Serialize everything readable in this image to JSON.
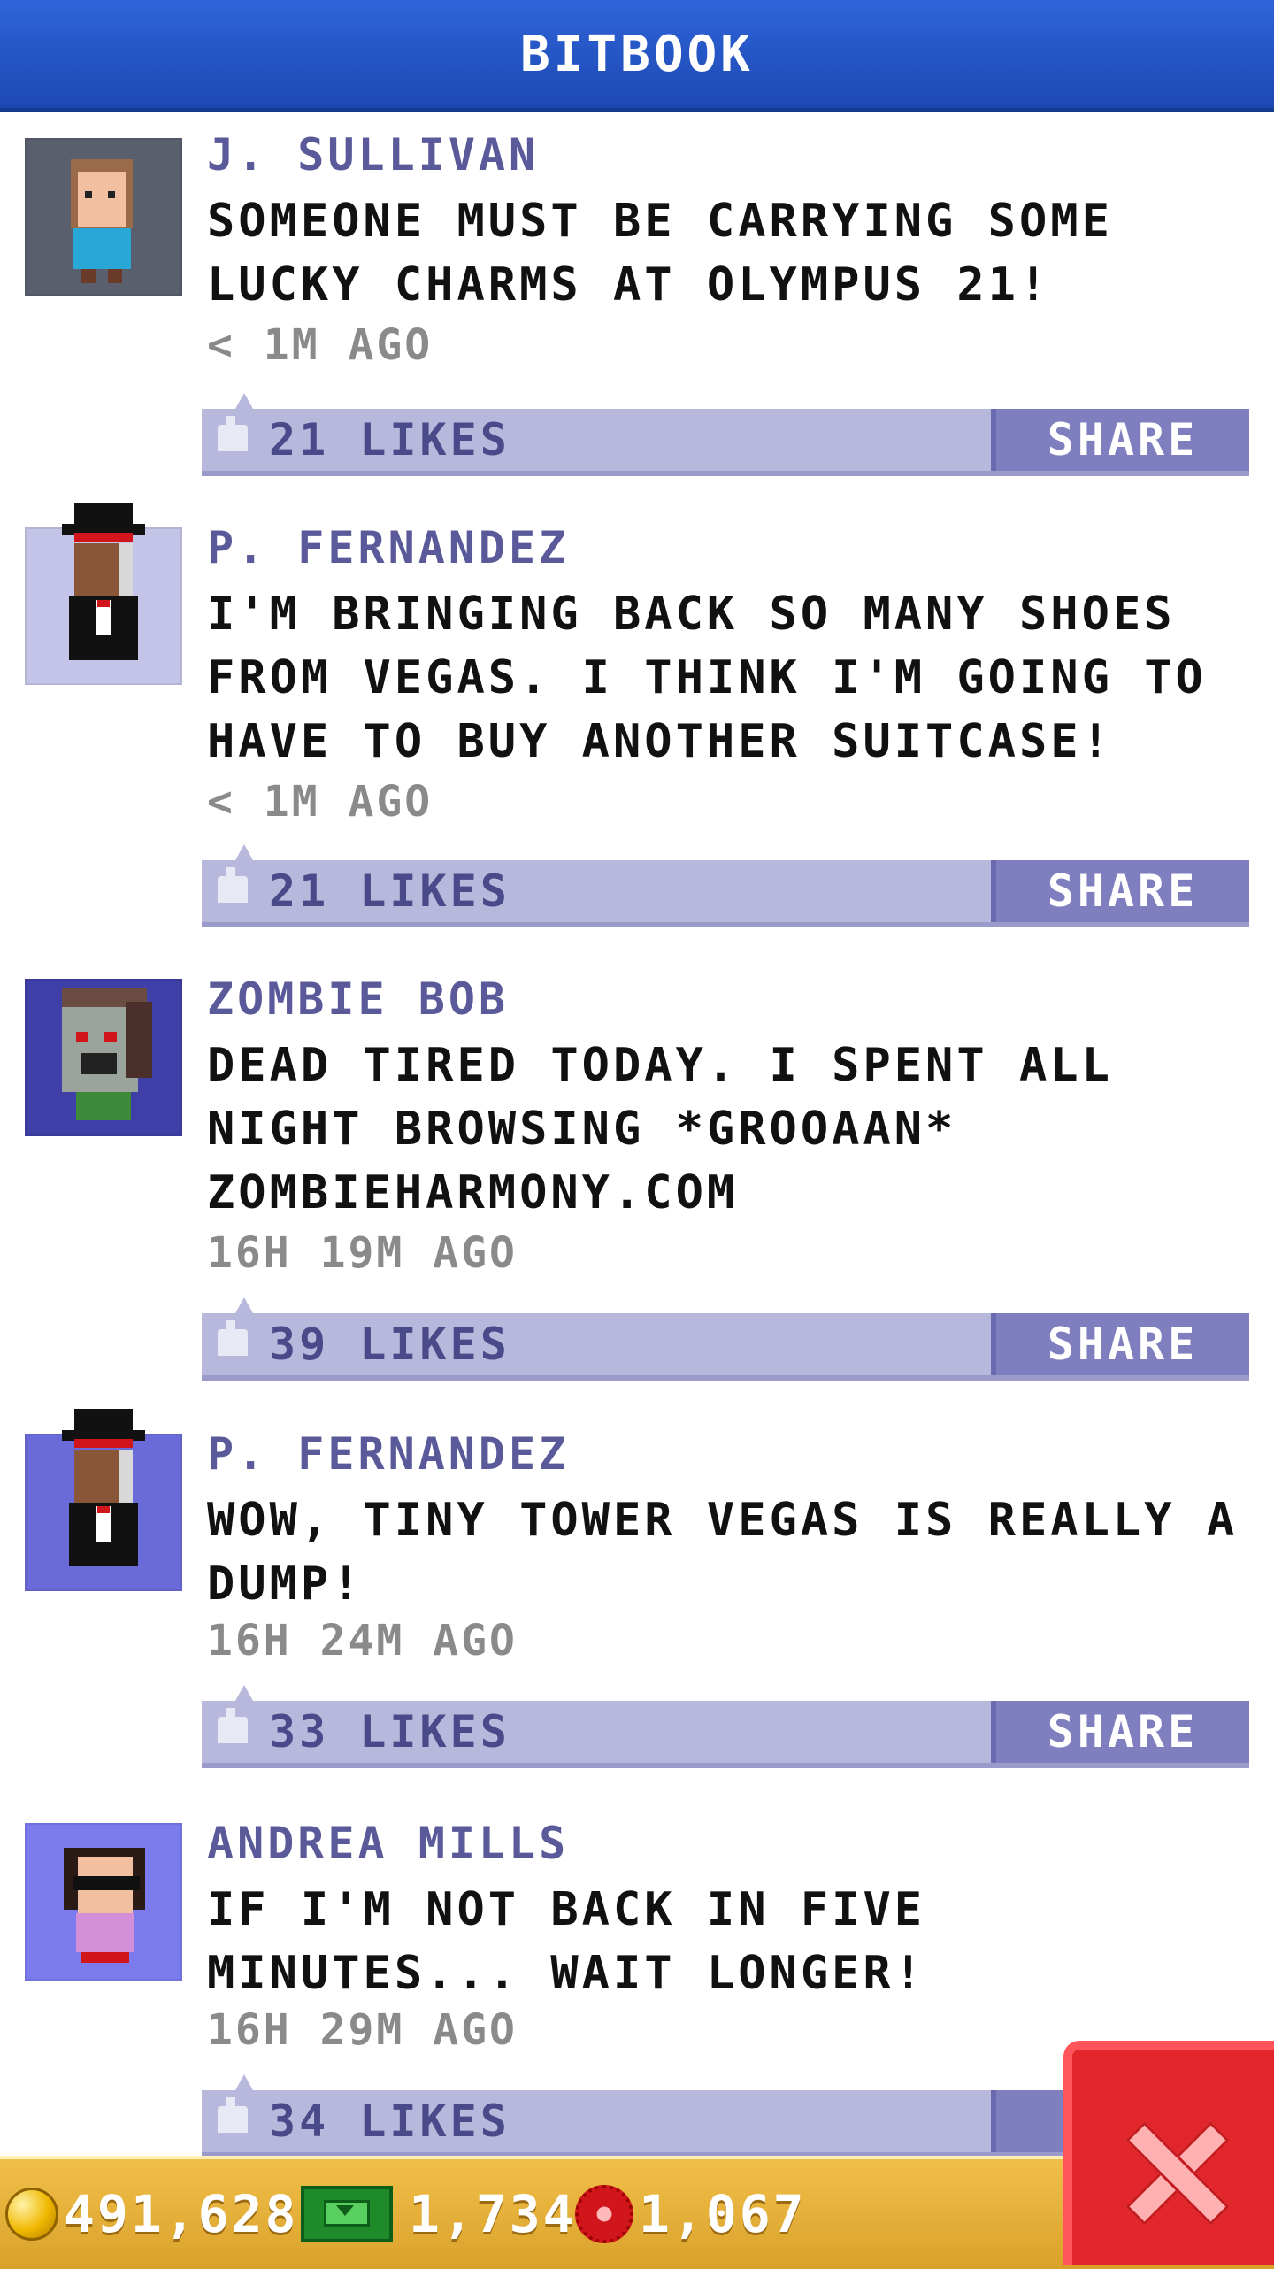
{
  "app": {
    "title": "BITBOOK"
  },
  "posts": [
    {
      "author": "J. SULLIVAN",
      "message": "SOMEONE MUST BE CARRYING SOME LUCKY CHARMS AT OLYMPUS 21!",
      "time": "< 1M AGO",
      "likes": "21 LIKES",
      "share": "SHARE",
      "avatar": "sullivan-avatar",
      "avatar_bg": "#5a5f6e"
    },
    {
      "author": "P. FERNANDEZ",
      "message": "I'M BRINGING BACK SO MANY SHOES FROM VEGAS. I THINK I'M GOING TO HAVE TO BUY ANOTHER SUITCASE!",
      "time": "< 1M AGO",
      "likes": "21 LIKES",
      "share": "SHARE",
      "avatar": "fernandez-avatar",
      "avatar_bg": "#c4c4e8"
    },
    {
      "author": "ZOMBIE BOB",
      "message": "DEAD TIRED TODAY. I SPENT ALL NIGHT BROWSING *GROOAAN* ZOMBIEHARMONY.COM",
      "time": "16H 19M AGO",
      "likes": "39 LIKES",
      "share": "SHARE",
      "avatar": "zombie-avatar",
      "avatar_bg": "#3f3fa8"
    },
    {
      "author": "P. FERNANDEZ",
      "message": "WOW, TINY TOWER VEGAS IS REALLY A DUMP!",
      "time": "16H 24M AGO",
      "likes": "33 LIKES",
      "share": "SHARE",
      "avatar": "fernandez-avatar",
      "avatar_bg": "#6a6ad8"
    },
    {
      "author": "ANDREA MILLS",
      "message": "IF I'M NOT BACK IN FIVE MINUTES... WAIT LONGER!",
      "time": "16H 29M AGO",
      "likes": "34 LIKES",
      "share": "S",
      "avatar": "andrea-avatar",
      "avatar_bg": "#7b7bee"
    }
  ],
  "currency": {
    "coins": "491,628",
    "bux": "1,734",
    "chips": "1,067"
  },
  "colors": {
    "header": "#1d48b3",
    "likebar": "#b8b8dc",
    "share": "#7f7fbf",
    "bottombar": "#d9a12a",
    "close": "#e2262b"
  }
}
